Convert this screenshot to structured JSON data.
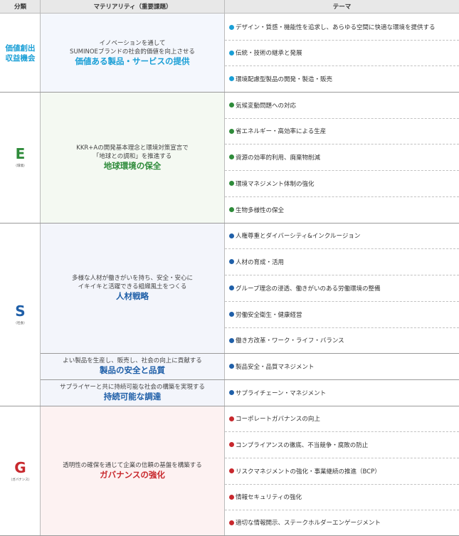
{
  "header": {
    "col_category": "分類",
    "col_materiality": "マテリアリティ（重要課題）",
    "col_theme": "テーマ"
  },
  "colors": {
    "value_creation": "#1a9fd6",
    "environment": "#2e8b3a",
    "social": "#1f5fa8",
    "governance": "#c8282d"
  },
  "groups": {
    "value": {
      "category": "価値創出収益機会",
      "mat": {
        "desc1": "イノベーションを通して",
        "desc2": "SUMINOEブランドの社会的価値を向上させる",
        "head": "価値ある製品・サービスの提供"
      },
      "themes": [
        "デザイン・質感・機能性を追求し、あらゆる空間に快適な環境を提供する",
        "伝統・技術の継承と発展",
        "環境配慮型製品の開発・製造・販売"
      ]
    },
    "env": {
      "category": "E",
      "category_sub": "（環境）",
      "mat": {
        "desc1": "KKR+Aの開発基本理念と環境対策宣言で",
        "desc2": "「地球との調和」を推進する",
        "head": "地球環境の保全"
      },
      "themes": [
        "気候変動問題への対応",
        "省エネルギー・高効率による生産",
        "資源の効率的利用、廃棄物削減",
        "環境マネジメント体制の強化",
        "生物多様性の保全"
      ]
    },
    "social": {
      "category": "S",
      "category_sub": "（社会）",
      "mat1": {
        "desc1": "多様な人材が働きがいを持ち、安全・安心に",
        "desc2": "イキイキと活躍できる組織風土をつくる",
        "head": "人材戦略"
      },
      "themes1": [
        "人権尊重とダイバーシティ&インクルージョン",
        "人材の育成・活用",
        "グループ理念の浸透、働きがいのある労働環境の整備",
        "労働安全衛生・健康経営",
        "働き方改革・ワーク・ライフ・バランス"
      ],
      "mat2": {
        "desc1": "よい製品を生産し、販売し、社会の向上に貢献する",
        "head": "製品の安全と品質"
      },
      "theme2": "製品安全・品質マネジメント",
      "mat3": {
        "desc1": "サプライヤーと共に持続可能な社会の構築を実現する",
        "head": "持続可能な調達"
      },
      "theme3": "サプライチェーン・マネジメント"
    },
    "gov": {
      "category": "G",
      "category_sub": "（ガバナンス）",
      "mat": {
        "desc1": "透明性の確保を通じて企業の信頼の基盤を構築する",
        "head": "ガバナンスの強化"
      },
      "themes": [
        "コーポレートガバナンスの向上",
        "コンプライアンスの徹底、不当競争・腐敗の防止",
        "リスクマネジメントの強化・事業継続の推進（BCP）",
        "情報セキュリティの強化",
        "適切な情報開示、ステークホルダーエンゲージメント"
      ]
    }
  }
}
